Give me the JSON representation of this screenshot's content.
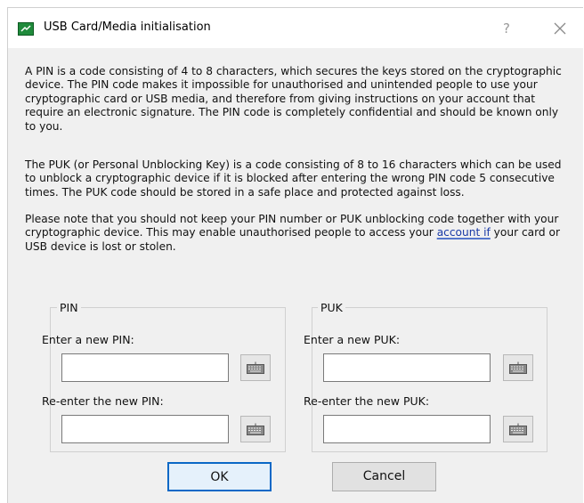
{
  "window": {
    "title": "USB Card/Media initialisation",
    "help_glyph": "?",
    "close_glyph": "×"
  },
  "content": {
    "para1": "A PIN is a code consisting of 4 to 8 characters, which secures the keys stored on the cryptographic device. The PIN code makes it impossible for unauthorised and unintended people to use your cryptographic card or USB media, and therefore from giving instructions on your account that require an electronic signature. The PIN code is completely confidential and should be known only to you.",
    "para2": "The PUK (or Personal Unblocking Key) is a code consisting of 8 to 16 characters which can be used to unblock a cryptographic device if it is blocked after entering the wrong PIN code 5 consecutive times. The PUK code should be stored in a safe place and protected against loss.",
    "para3_before_link": "Please note that you should not keep your PIN number or PUK unblocking code together with your cryptographic device. This may enable unauthorised people to access your ",
    "para3_link": "account  if",
    "para3_after_link": " your card or USB device is lost or stolen."
  },
  "pin_group": {
    "legend": "PIN",
    "new_label": "Enter a new PIN:",
    "new_value": "",
    "confirm_label": "Re-enter the new PIN:",
    "confirm_value": ""
  },
  "puk_group": {
    "legend": "PUK",
    "new_label": "Enter a new PUK:",
    "new_value": "",
    "confirm_label": "Re-enter the new PUK:",
    "confirm_value": ""
  },
  "buttons": {
    "ok": "OK",
    "cancel": "Cancel"
  },
  "icons": {
    "app": "usb-card-icon",
    "keyboard": "keyboard-icon"
  },
  "colors": {
    "app_icon": "#1f8a3b",
    "default_button_border": "#0a68c6",
    "link": "#1a3aa6"
  }
}
